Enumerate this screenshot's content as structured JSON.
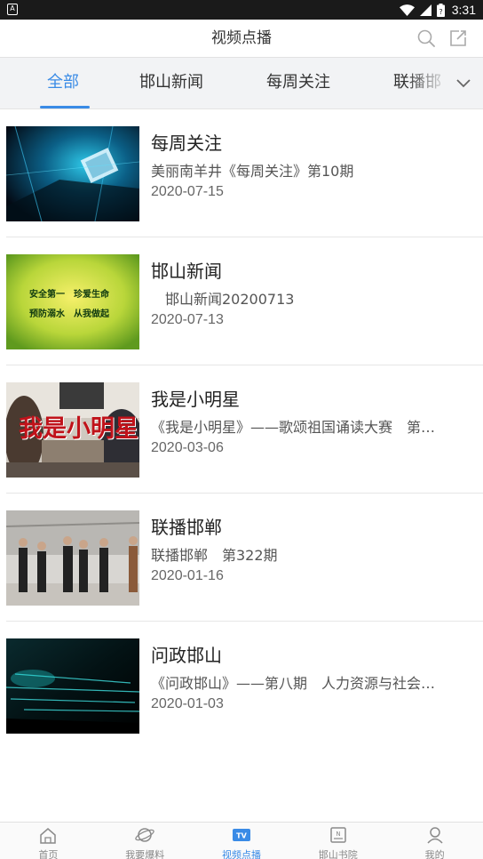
{
  "status_bar": {
    "time": "3:31",
    "left_icon_label": "A",
    "colors": {
      "background": "#1a1a1a",
      "foreground": "#ffffff"
    }
  },
  "header": {
    "title": "视频点播",
    "search_icon": "search-icon",
    "share_icon": "share-icon"
  },
  "tabs": {
    "items": [
      {
        "label": "全部",
        "active": true
      },
      {
        "label": "邯山新闻",
        "active": false
      },
      {
        "label": "每周关注",
        "active": false
      },
      {
        "label": "联播邯",
        "active": false
      }
    ],
    "more_icon": "chevron-down-icon",
    "accent_color": "#3a8be6"
  },
  "videos": [
    {
      "title": "每周关注",
      "desc": "美丽南羊井《每周关注》第10期",
      "date": "2020-07-15",
      "thumb_style": "abstract-blue"
    },
    {
      "title": "邯山新闻",
      "desc": "　邯山新闻20200713",
      "date": "2020-07-13",
      "thumb_style": "yellow-green-slogan",
      "thumb_text": [
        "安全第一　珍爱生命",
        "预防溺水　从我做起"
      ]
    },
    {
      "title": "我是小明星",
      "desc": "《我是小明星》——歌颂祖国诵读大赛　第…",
      "date": "2020-03-06",
      "thumb_style": "red-caption",
      "thumb_text": [
        "我是小明星"
      ]
    },
    {
      "title": "联播邯郸",
      "desc": "联播邯郸　第322期",
      "date": "2020-01-16",
      "thumb_style": "people-standing"
    },
    {
      "title": "问政邯山",
      "desc": "《问政邯山》——第八期　人力资源与社会…",
      "date": "2020-01-03",
      "thumb_style": "dark-teal-stage"
    }
  ],
  "bottom_nav": [
    {
      "label": "首页",
      "icon": "home-icon",
      "active": false
    },
    {
      "label": "我要爆料",
      "icon": "planet-icon",
      "active": false
    },
    {
      "label": "视频点播",
      "icon": "tv-icon",
      "active": true
    },
    {
      "label": "邯山书院",
      "icon": "book-icon",
      "active": false
    },
    {
      "label": "我的",
      "icon": "user-icon",
      "active": false
    }
  ]
}
